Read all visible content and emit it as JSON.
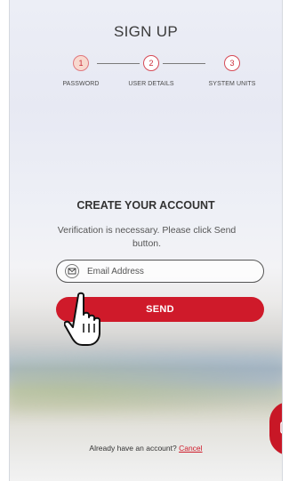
{
  "header": {
    "title": "SIGN UP"
  },
  "stepper": {
    "steps": [
      {
        "number": "1",
        "label": "PASSWORD",
        "active": true
      },
      {
        "number": "2",
        "label": "USER DETAILS",
        "active": false
      },
      {
        "number": "3",
        "label": "SYSTEM UNITS",
        "active": false
      }
    ]
  },
  "form": {
    "heading": "CREATE YOUR ACCOUNT",
    "description": "Verification is necessary. Please click Send button.",
    "email_placeholder": "Email Address",
    "email_value": "",
    "email_icon": "envelope-icon",
    "send_label": "SEND"
  },
  "footer": {
    "text": "Already have an account?",
    "link_label": "Cancel"
  },
  "overlay": {
    "cursor": "hand-pointer-cursor",
    "chat_button_icon": "chat-bubble-icon"
  },
  "colors": {
    "brand": "#cf1a2a",
    "active_step_fill": "#f8d9cf",
    "text": "#333333"
  }
}
